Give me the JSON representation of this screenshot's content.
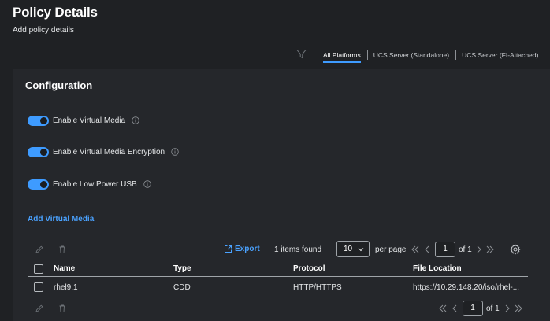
{
  "header": {
    "title": "Policy Details",
    "subtitle": "Add policy details"
  },
  "platform_tabs": [
    {
      "label": "All Platforms",
      "active": true
    },
    {
      "label": "UCS Server (Standalone)",
      "active": false
    },
    {
      "label": "UCS Server (FI-Attached)",
      "active": false
    }
  ],
  "configuration": {
    "title": "Configuration",
    "toggles": [
      {
        "label": "Enable Virtual Media",
        "on": true
      },
      {
        "label": "Enable Virtual Media Encryption",
        "on": true
      },
      {
        "label": "Enable Low Power USB",
        "on": true
      }
    ],
    "add_link": "Add Virtual Media"
  },
  "table_toolbar": {
    "export_label": "Export",
    "items_found": "1 items found",
    "page_size": "10",
    "per_page_label": "per page",
    "current_page": "1",
    "of_label": "of 1"
  },
  "table": {
    "columns": [
      "Name",
      "Type",
      "Protocol",
      "File Location"
    ],
    "rows": [
      {
        "name": "rhel9.1",
        "type": "CDD",
        "protocol": "HTTP/HTTPS",
        "file_location": "https://10.29.148.20/iso/rhel-..."
      }
    ]
  },
  "footer_pager": {
    "current_page": "1",
    "of_label": "of 1"
  },
  "colors": {
    "background": "#1f2124",
    "panel": "#25272b",
    "accent": "#3e9bff",
    "link": "#4aa2ff"
  }
}
